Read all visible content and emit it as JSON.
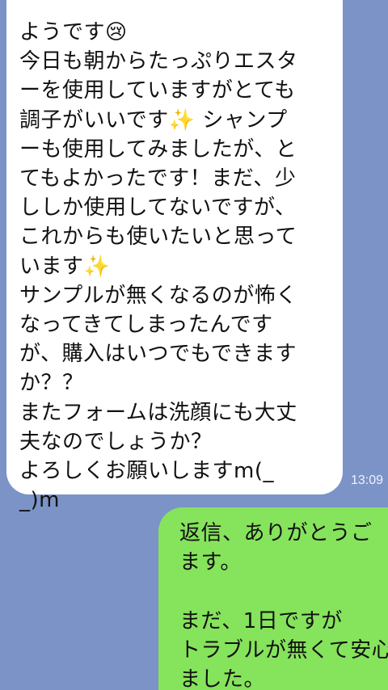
{
  "chat": {
    "incoming": {
      "text": "ようです😢\n今日も朝からたっぷりエスター使用していますがとても調子がいいです✨ シャンプーも使用してみましたが、とてもよかったです！まだ、少ししか使用してないですが、これからも使いたいと思っています✨\nサンプルが無くなるのが怖くなってきてしまったんですが、購入はいつでもできますか？？\nまたフォームは洗顔にも大丈夫なのでしょうか？\nよろしくお願いしますm(_ _)m",
      "lines": [
        "ようです😢",
        "今日も朝からたっぷりエスタ",
        "ーを使用していますがとても",
        "調子がいいです✨ シャンプ",
        "ーも使用してみましたが、と",
        "てもよかったです！まだ、少",
        "ししか使用してないですが、",
        "これからも使いたいと思って",
        "います✨",
        "サンプルが無くなるのが怖く",
        "なってきてしまったんです",
        "が、購入はいつでもできます",
        "か？？",
        "またフォームは洗顔にも大丈",
        "夫なのでしょうか？",
        "よろしくお願いしますm(_",
        "_)m"
      ],
      "time": "13:09"
    },
    "outgoing": {
      "lines": [
        "返信、ありがとうご",
        "ます。",
        "",
        "まだ、1日ですが",
        "トラブルが無くて安心",
        "ました。"
      ]
    },
    "colors": {
      "background": "#7b93c7",
      "incoming_bubble": "#ffffff",
      "outgoing_bubble": "#86e35c"
    }
  }
}
